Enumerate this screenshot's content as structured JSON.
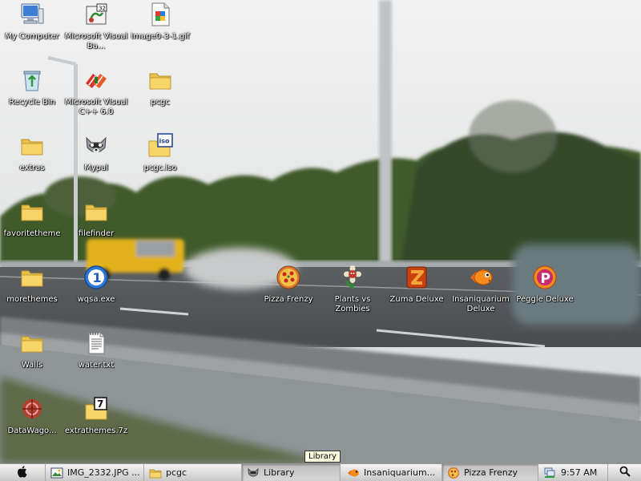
{
  "desktop": {
    "icons": [
      {
        "label": "My Computer",
        "icon": "computer-icon"
      },
      {
        "label": "Microsoft Visual Ba...",
        "icon": "visual-basic-icon"
      },
      {
        "label": "image0-3-1.gif",
        "icon": "gif-file-icon"
      },
      {
        "label": "Recycle Bin",
        "icon": "recycle-bin-icon"
      },
      {
        "label": "Microsoft Visual C++ 6.0",
        "icon": "visual-cpp-icon"
      },
      {
        "label": "pcgc",
        "icon": "folder-icon"
      },
      {
        "label": "extras",
        "icon": "folder-icon"
      },
      {
        "label": "Mypal",
        "icon": "raccoon-icon"
      },
      {
        "label": "pcgc.iso",
        "icon": "iso-file-icon"
      },
      {
        "label": "favoritetheme",
        "icon": "folder-icon"
      },
      {
        "label": "filefinder",
        "icon": "folder-icon"
      },
      {
        "label": "morethemes",
        "icon": "folder-icon"
      },
      {
        "label": "wqsa.exe",
        "icon": "exe-1-icon"
      },
      {
        "label": "Pizza Frenzy",
        "icon": "pizza-icon"
      },
      {
        "label": "Plants vs Zombies",
        "icon": "plants-vs-zombies-icon"
      },
      {
        "label": "Zuma Deluxe",
        "icon": "zuma-icon"
      },
      {
        "label": "Insaniquarium Deluxe",
        "icon": "goldfish-icon"
      },
      {
        "label": "Peggle Deluxe",
        "icon": "peggle-icon"
      },
      {
        "label": "Walls",
        "icon": "folder-icon"
      },
      {
        "label": "water.txt",
        "icon": "text-file-icon"
      },
      {
        "label": "DataWago...",
        "icon": "datawagon-icon"
      },
      {
        "label": "extrathemes.7z",
        "icon": "7z-archive-icon"
      }
    ]
  },
  "taskbar": {
    "tasks": [
      {
        "label": "IMG_2332.JPG ...",
        "icon": "image-icon"
      },
      {
        "label": "pcgc",
        "icon": "folder-icon"
      },
      {
        "label": "Library",
        "icon": "raccoon-icon"
      },
      {
        "label": "Insaniquarium...",
        "icon": "goldfish-icon"
      },
      {
        "label": "Pizza Frenzy",
        "icon": "pizza-icon"
      }
    ],
    "clock": "9:57 AM",
    "tooltip": "Library"
  },
  "colors": {
    "folder": "#f2d060",
    "label_text": "#ffffff",
    "taskbar": "#dcdcdc",
    "tooltip_bg": "#ffffe1"
  }
}
